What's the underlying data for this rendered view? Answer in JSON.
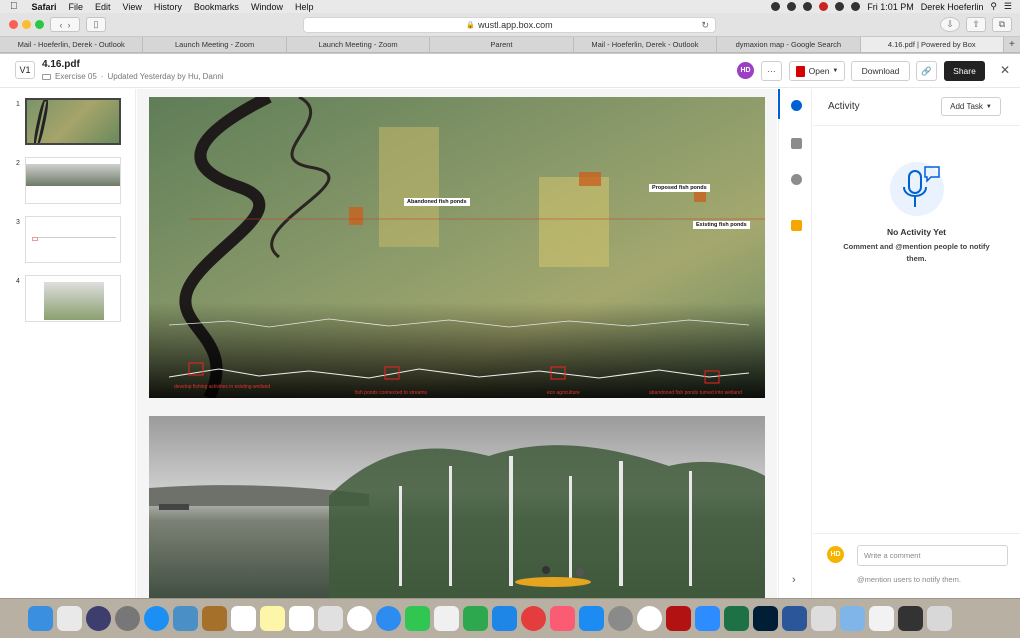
{
  "menubar": {
    "app": "Safari",
    "items": [
      "File",
      "Edit",
      "View",
      "History",
      "Bookmarks",
      "Window",
      "Help"
    ],
    "clock": "Fri 1:01 PM",
    "user": "Derek Hoeferlin"
  },
  "browser": {
    "url": "wustl.app.box.com",
    "tabs": [
      "Mail - Hoeferlin, Derek - Outlook",
      "Launch Meeting - Zoom",
      "Launch Meeting - Zoom",
      "Parent",
      "Mail - Hoeferlin, Derek - Outlook",
      "dymaxion map - Google Search",
      "4.16.pdf | Powered by Box"
    ],
    "active_tab": 6
  },
  "header": {
    "version": "V1",
    "filename": "4.16.pdf",
    "folder": "Exercise 05",
    "updated": "Updated Yesterday by Hu, Danni",
    "avatar": "HD",
    "more": "···",
    "open": "Open",
    "download": "Download",
    "share": "Share"
  },
  "thumbnails": [
    "1",
    "2",
    "3",
    "4"
  ],
  "page1_labels": {
    "abandoned": "Abandoned fish ponds",
    "proposed": "Proposed fish ponds",
    "existing": "Existing fish ponds",
    "red1": "develop fishing activities in existing wetland",
    "red2": "fish ponds connected to streams",
    "red3": "eco agriculture",
    "red4": "abandoned fish ponds turned into wetland"
  },
  "activity": {
    "title": "Activity",
    "add_task": "Add Task",
    "empty_title": "No Activity Yet",
    "empty_sub": "Comment and @mention people to notify them.",
    "comment_avatar": "HD",
    "comment_placeholder": "Write a comment",
    "mention_hint": "@mention users to notify them."
  },
  "colors": {
    "avatar_purple": "#9b3fc4",
    "avatar_yellow": "#f5b400",
    "box_blue": "#0061d5",
    "pdf_red": "#d50000"
  }
}
